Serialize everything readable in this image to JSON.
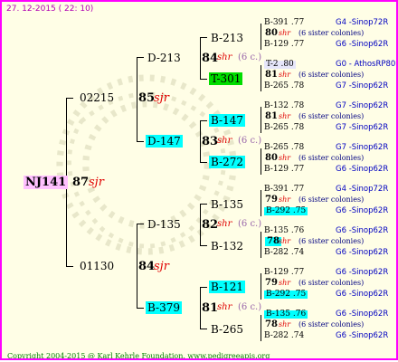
{
  "date": "27. 12-2015 ( 22: 10)",
  "copyright": "Copyright 2004-2015 @ Karl Kehrle Foundation.   www.pedigreeapis.org",
  "root": {
    "id": "NJ141",
    "year": "87",
    "breed": "sjr"
  },
  "gen1": [
    {
      "id": "02215",
      "year": "85",
      "breed": "sjr"
    },
    {
      "id": "01130",
      "year": "84",
      "breed": "sjr"
    }
  ],
  "gen2": [
    {
      "id": "D-213",
      "year": "84",
      "breed": "shr",
      "sib": "(6 c.)"
    },
    {
      "id": "D-147",
      "year": "83",
      "breed": "shr",
      "sib": "(6 c.)"
    },
    {
      "id": "D-135",
      "year": "82",
      "breed": "shr",
      "sib": "(6 c.)"
    },
    {
      "id": "B-379",
      "year": "81",
      "breed": "shr",
      "sib": "(6 c.)"
    }
  ],
  "gen3": [
    {
      "id": "B-213"
    },
    {
      "id": "T-301"
    },
    {
      "id": "B-147"
    },
    {
      "id": "B-272"
    },
    {
      "id": "B-135"
    },
    {
      "id": "B-132"
    },
    {
      "id": "B-121"
    },
    {
      "id": "B-265"
    }
  ],
  "gen4": [
    {
      "top": "B-391 .77",
      "year": "80",
      "breed": "shr",
      "sib": "(6 sister colonies)",
      "bot": "B-129 .77",
      "o1": "G4 -Sinop72R",
      "o2": "G6 -Sinop62R"
    },
    {
      "top": "T-2 .80",
      "year": "81",
      "breed": "shr",
      "sib": "(6 sister colonies)",
      "bot": "B-265 .78",
      "o1": "G0 - AthosRP80R",
      "o2": "G7 -Sinop62R"
    },
    {
      "top": "B-132 .78",
      "year": "81",
      "breed": "shr",
      "sib": "(6 sister colonies)",
      "bot": "B-265 .78",
      "o1": "G7 -Sinop62R",
      "o2": "G7 -Sinop62R"
    },
    {
      "top": "B-265 .78",
      "year": "80",
      "breed": "shr",
      "sib": "(6 sister colonies)",
      "bot": "B-129 .77",
      "o1": "G7 -Sinop62R",
      "o2": "G6 -Sinop62R"
    },
    {
      "top": "B-391 .77",
      "year": "79",
      "breed": "shr",
      "sib": "(6 sister colonies)",
      "bot": "B-292 .75",
      "o1": "G4 -Sinop72R",
      "o2": "G6 -Sinop62R"
    },
    {
      "top": "B-135 .76",
      "year": "78",
      "breed": "shr",
      "sib": "(6 sister colonies)",
      "bot": "B-282 .74",
      "o1": "G6 -Sinop62R",
      "o2": "G6 -Sinop62R"
    },
    {
      "top": "B-129 .77",
      "year": "79",
      "breed": "shr",
      "sib": "(6 sister colonies)",
      "bot": "B-292 .75",
      "o1": "G6 -Sinop62R",
      "o2": "G6 -Sinop62R"
    },
    {
      "top": "B-135 .76",
      "year": "78",
      "breed": "shr",
      "sib": "(6 sister colonies)",
      "bot": "B-282 .74",
      "o1": "G6 -Sinop62R",
      "o2": "G6 -Sinop62R"
    }
  ],
  "colors": {
    "border": "#ff00ff",
    "highlight": "#00ffff",
    "highlight_green": "#00dd00",
    "breed": "#e00000",
    "origin": "#0000c0"
  }
}
